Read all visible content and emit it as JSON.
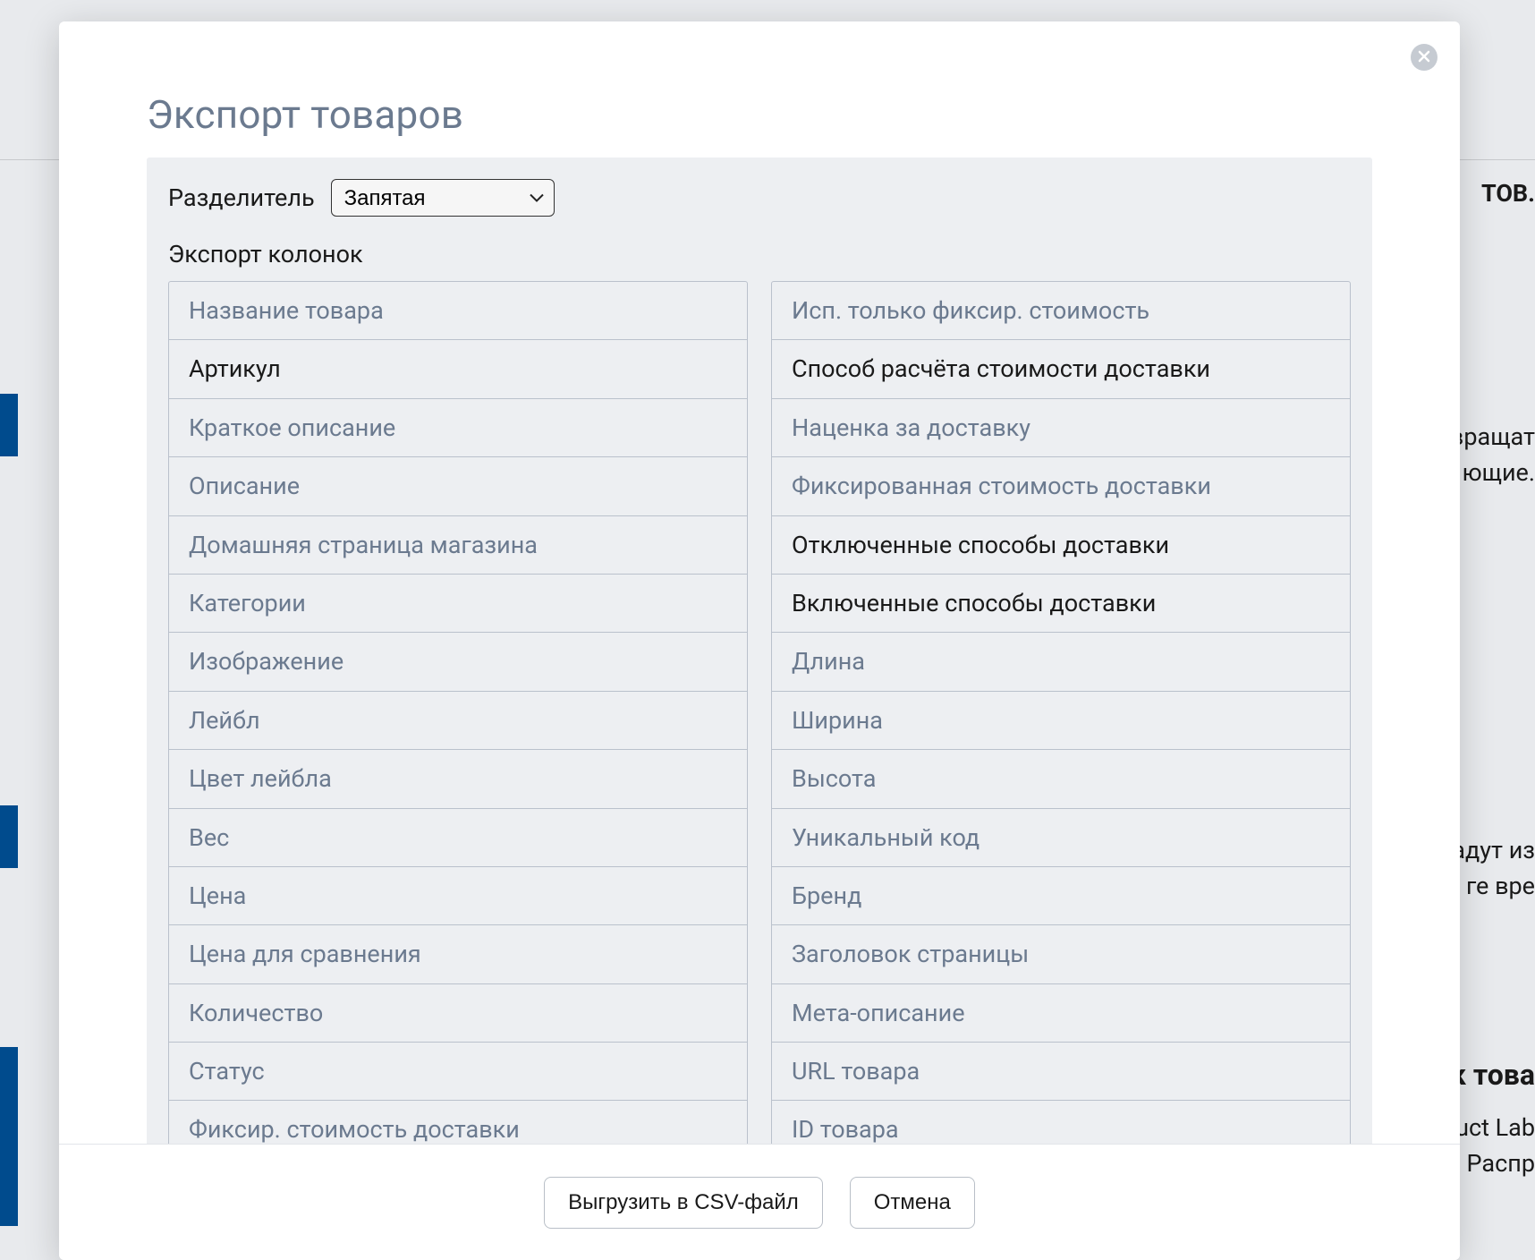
{
  "background": {
    "bar_top_label": "ТОВ.",
    "text1_a": "вращат",
    "text1_b": "ющие.",
    "text2_a": "адут из",
    "text2_b": "ге вре",
    "heading2": "к това",
    "text3_a": "uct Lab",
    "text3_b": "Распр"
  },
  "modal": {
    "title": "Экспорт товаров",
    "delimiter_label": "Разделитель",
    "delimiter_value": "Запятая",
    "export_columns_label": "Экспорт колонок",
    "left": [
      {
        "label": "Название товара",
        "selected": false
      },
      {
        "label": "Артикул",
        "selected": true
      },
      {
        "label": "Краткое описание",
        "selected": false
      },
      {
        "label": "Описание",
        "selected": false
      },
      {
        "label": "Домашняя страница магазина",
        "selected": false
      },
      {
        "label": "Категории",
        "selected": false
      },
      {
        "label": "Изображение",
        "selected": false
      },
      {
        "label": "Лейбл",
        "selected": false
      },
      {
        "label": "Цвет лейбла",
        "selected": false
      },
      {
        "label": "Вес",
        "selected": false
      },
      {
        "label": "Цена",
        "selected": false
      },
      {
        "label": "Цена для сравнения",
        "selected": false
      },
      {
        "label": "Количество",
        "selected": false
      },
      {
        "label": "Статус",
        "selected": false
      },
      {
        "label": "Фиксир. стоимость доставки",
        "selected": false
      }
    ],
    "right": [
      {
        "label": "Исп. только фиксир. стоимость",
        "selected": false
      },
      {
        "label": "Способ расчёта стоимости доставки",
        "selected": true
      },
      {
        "label": "Наценка за доставку",
        "selected": false
      },
      {
        "label": "Фиксированная стоимость доставки",
        "selected": false
      },
      {
        "label": "Отключенные способы доставки",
        "selected": true
      },
      {
        "label": "Включенные способы доставки",
        "selected": true
      },
      {
        "label": "Длина",
        "selected": false
      },
      {
        "label": "Ширина",
        "selected": false
      },
      {
        "label": "Высота",
        "selected": false
      },
      {
        "label": "Уникальный код",
        "selected": false
      },
      {
        "label": "Бренд",
        "selected": false
      },
      {
        "label": "Заголовок страницы",
        "selected": false
      },
      {
        "label": "Мета-описание",
        "selected": false
      },
      {
        "label": "URL товара",
        "selected": false
      },
      {
        "label": "ID товара",
        "selected": false
      }
    ],
    "export_button": "Выгрузить в CSV-файл",
    "cancel_button": "Отмена"
  }
}
